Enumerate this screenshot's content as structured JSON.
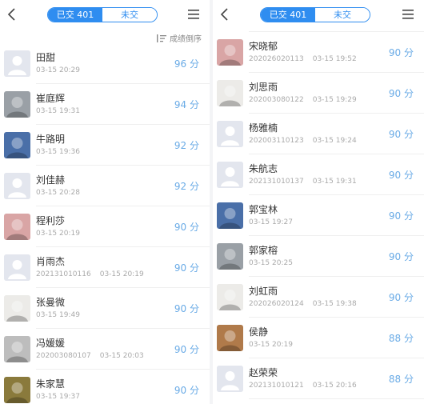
{
  "colors": {
    "accent": "#2f8df0",
    "score": "#6aabe6",
    "meta": "#aaaaaa",
    "divider": "#efefef"
  },
  "left": {
    "tabs": [
      {
        "label": "已交 401",
        "active": true
      },
      {
        "label": "未交",
        "active": false
      }
    ],
    "sort_label": "成绩倒序",
    "rows": [
      {
        "name": "田甜",
        "id": "",
        "time": "03-15 20:29",
        "score": "96 分",
        "avatar": "placeholder"
      },
      {
        "name": "崔庭辉",
        "id": "",
        "time": "03-15 19:31",
        "score": "94 分",
        "avatar": "photo-gray"
      },
      {
        "name": "牛路明",
        "id": "",
        "time": "03-15 19:36",
        "score": "92 分",
        "avatar": "photo-blue"
      },
      {
        "name": "刘佳赫",
        "id": "",
        "time": "03-15 20:28",
        "score": "92 分",
        "avatar": "placeholder"
      },
      {
        "name": "程利莎",
        "id": "",
        "time": "03-15 20:19",
        "score": "90 分",
        "avatar": "photo-pink"
      },
      {
        "name": "肖雨杰",
        "id": "202131010116",
        "time": "03-15 20:19",
        "score": "90 分",
        "avatar": "placeholder"
      },
      {
        "name": "张曼微",
        "id": "",
        "time": "03-15 19:49",
        "score": "90 分",
        "avatar": "photo-light"
      },
      {
        "name": "冯媛媛",
        "id": "202003080107",
        "time": "03-15 20:03",
        "score": "90 分",
        "avatar": "photo-bw"
      },
      {
        "name": "朱家慧",
        "id": "",
        "time": "03-15 19:37",
        "score": "90 分",
        "avatar": "photo-olive"
      }
    ]
  },
  "right": {
    "tabs": [
      {
        "label": "已交 401",
        "active": true
      },
      {
        "label": "未交",
        "active": false
      }
    ],
    "rows": [
      {
        "name": "",
        "id": "",
        "time": "",
        "score": "",
        "avatar": "photo-warm"
      },
      {
        "name": "宋晓郁",
        "id": "202026020113",
        "time": "03-15 19:52",
        "score": "90 分",
        "avatar": "photo-pink"
      },
      {
        "name": "刘思雨",
        "id": "202003080122",
        "time": "03-15 19:29",
        "score": "90 分",
        "avatar": "photo-light"
      },
      {
        "name": "杨雅楠",
        "id": "202003110123",
        "time": "03-15 19:24",
        "score": "90 分",
        "avatar": "placeholder"
      },
      {
        "name": "朱航志",
        "id": "202131010137",
        "time": "03-15 19:31",
        "score": "90 分",
        "avatar": "placeholder"
      },
      {
        "name": "郭宝林",
        "id": "",
        "time": "03-15 19:27",
        "score": "90 分",
        "avatar": "photo-blue"
      },
      {
        "name": "郭家榕",
        "id": "",
        "time": "03-15 20:25",
        "score": "90 分",
        "avatar": "photo-gray"
      },
      {
        "name": "刘虹雨",
        "id": "202026020124",
        "time": "03-15 19:38",
        "score": "90 分",
        "avatar": "photo-light"
      },
      {
        "name": "侯静",
        "id": "",
        "time": "03-15 20:19",
        "score": "88 分",
        "avatar": "photo-warm"
      },
      {
        "name": "赵荣荣",
        "id": "202131010121",
        "time": "03-15 20:16",
        "score": "88 分",
        "avatar": "placeholder"
      }
    ]
  }
}
